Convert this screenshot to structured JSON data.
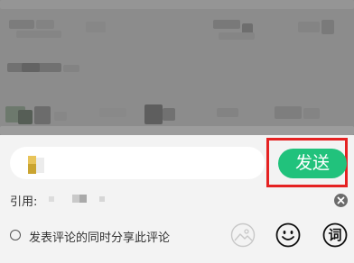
{
  "comment_box": {
    "send_label": "发送"
  },
  "quote": {
    "label": "引用:"
  },
  "share_option": {
    "label": "发表评论的同时分享此评论",
    "checked": false
  },
  "toolbar": {
    "image_icon": "image-icon",
    "emoji_icon": "smiley-icon",
    "word_icon_glyph": "词"
  },
  "colors": {
    "send_button": "#21c27c",
    "highlight_border": "#e52222",
    "sheet_background": "#f3f3f3"
  }
}
